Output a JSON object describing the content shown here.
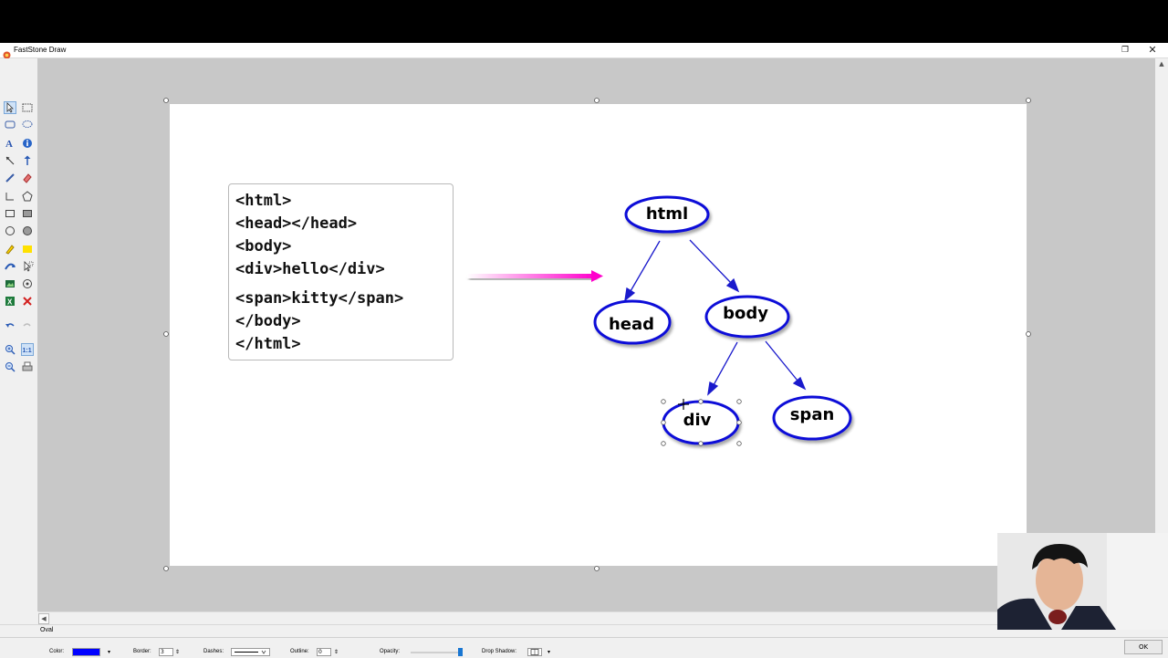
{
  "window": {
    "title": "FastStone Draw",
    "restore_icon": "restore-icon",
    "close_icon": "close-icon",
    "close_glyph": "✕",
    "restore_glyph": "❐"
  },
  "toolbox": {
    "tools": [
      "select-icon",
      "rect-select-icon",
      "lasso-icon",
      "lasso-free-icon",
      "text-icon",
      "info-icon",
      "line-arrow-icon",
      "up-arrow-icon",
      "pen-icon",
      "eraser-icon",
      "polyline-icon",
      "polygon-icon",
      "rectangle-icon",
      "filled-rectangle-icon",
      "circle-icon",
      "filled-circle-icon",
      "highlighter-icon",
      "yellow-fill-icon",
      "curve-arrow-icon",
      "cursor-arrow-icon",
      "image-icon",
      "stamp-icon",
      "excel-icon",
      "delete-icon",
      "undo-icon",
      "redo-icon",
      "zoom-in-icon",
      "actual-size-icon",
      "zoom-out-icon",
      "print-icon"
    ]
  },
  "canvas": {
    "code_lines": [
      "<html>",
      "<head></head>",
      "<body>",
      "<div>hello</div>",
      "<span>kitty</span>",
      "</body>",
      "</html>"
    ],
    "nodes": {
      "html": "html",
      "head": "head",
      "body": "body",
      "div": "div",
      "span": "span"
    },
    "arrow_color": "#ff00cc",
    "edge_color": "#1a1acc",
    "node_border_color": "#1010d8"
  },
  "status": {
    "text": "Oval"
  },
  "properties": {
    "color_label": "Color:",
    "color_value": "#0000ff",
    "border_label": "Border:",
    "border_value": "3",
    "dashes_label": "Dashes:",
    "outline_label": "Outline:",
    "outline_value": "0",
    "opacity_label": "Opacity:",
    "drop_shadow_label": "Drop Shadow:",
    "ok_label": "OK"
  }
}
